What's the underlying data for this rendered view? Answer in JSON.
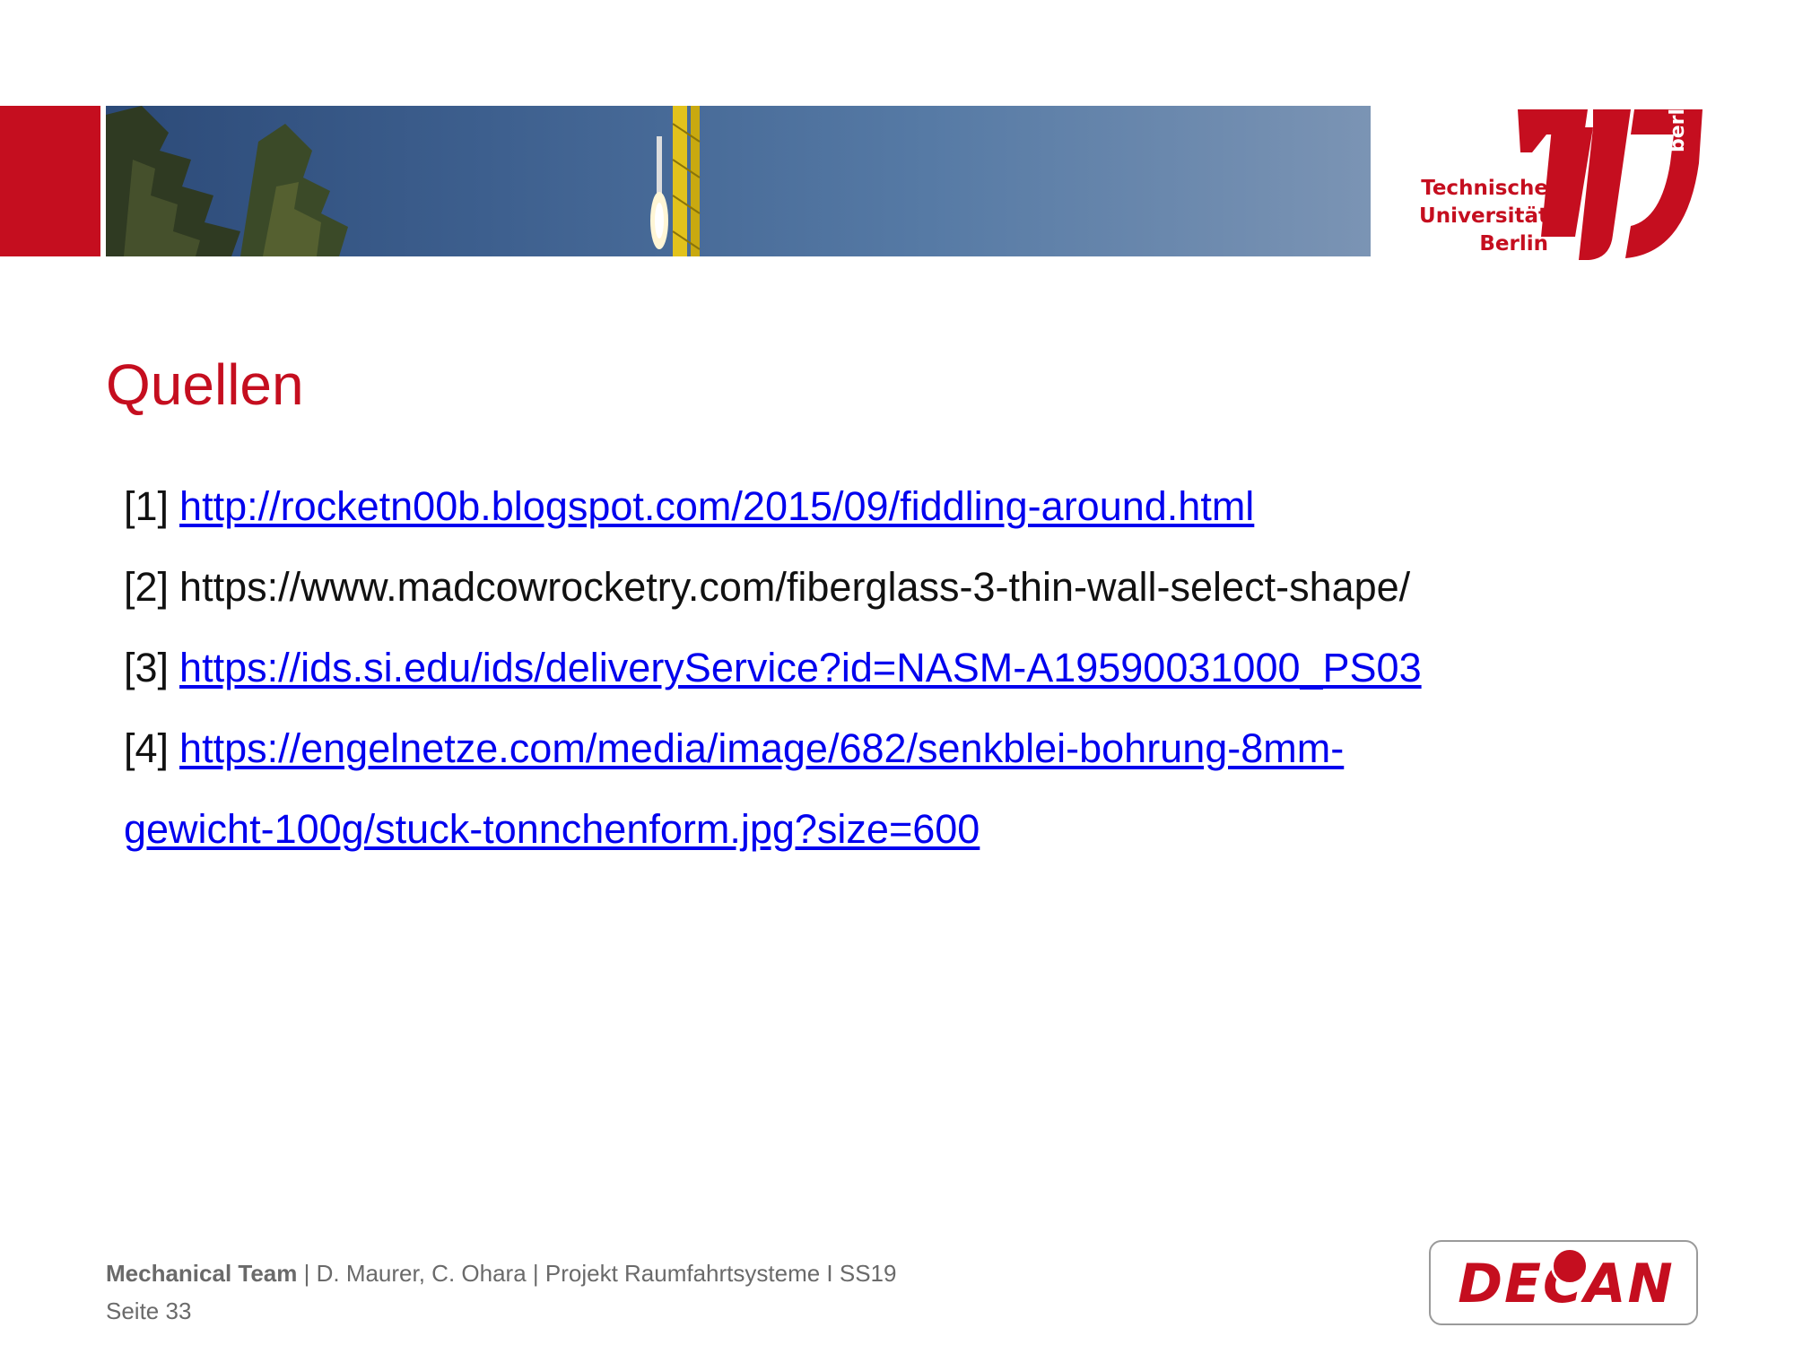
{
  "header": {
    "banner_image": "rocket-launch-photo",
    "logo": {
      "line1": "Technische",
      "line2": "Universität",
      "line3": "Berlin",
      "vertical": "berlin"
    }
  },
  "slide": {
    "title": "Quellen",
    "references": [
      {
        "num": "[1]",
        "text": "http://rocketn00b.blogspot.com/2015/09/fiddling-around.html",
        "link": true
      },
      {
        "num": "[2]",
        "text": "https://www.madcowrocketry.com/fiberglass-3-thin-wall-select-shape/",
        "link": false
      },
      {
        "num": "[3]",
        "text": "https://ids.si.edu/ids/deliveryService?id=NASM-A19590031000_PS03",
        "link": true
      },
      {
        "num": "[4]",
        "text": "https://engelnetze.com/media/image/682/senkblei-bohrung-8mm-",
        "link": true
      },
      {
        "num": "",
        "text": "gewicht-100g/stuck-tonnchenform.jpg?size=600",
        "link": true
      }
    ]
  },
  "footer": {
    "team": "Mechanical Team",
    "sep": " |  ",
    "details": "D. Maurer, C. Ohara | Projekt Raumfahrtsysteme I SS19",
    "page": "Seite 33",
    "logo_text": "DECAN"
  },
  "colors": {
    "accent": "#c50e1f",
    "link": "#0000ee",
    "footer_text": "#6a6a6a"
  }
}
